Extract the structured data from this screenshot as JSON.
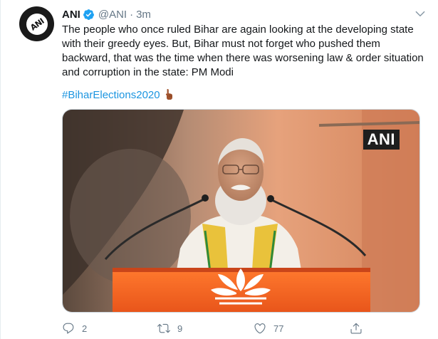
{
  "tweet": {
    "author_name": "ANI",
    "handle": "@ANI",
    "separator": "·",
    "time": "3m",
    "text_lines": [
      "The people who once ruled Bihar are again looking at the developing state",
      "with their greedy eyes. But, Bihar must not forget who pushed them",
      "backward, that was the time when there was worsening law & order situation",
      "and corruption in the state: PM Modi"
    ],
    "hashtag": "#BiharElections2020",
    "media_watermark": "ANI",
    "avatar_logo_text": "ANI"
  },
  "actions": {
    "reply_count": "2",
    "retweet_count": "9",
    "like_count": "77"
  },
  "colors": {
    "link": "#1b95e0",
    "secondary_text": "#657786",
    "primary_text": "#14171a",
    "verified_badge": "#1da1f2"
  },
  "icons": [
    "verified-badge-icon",
    "caret-down-icon",
    "reply-icon",
    "retweet-icon",
    "like-icon",
    "share-icon",
    "index-finger-emoji"
  ]
}
